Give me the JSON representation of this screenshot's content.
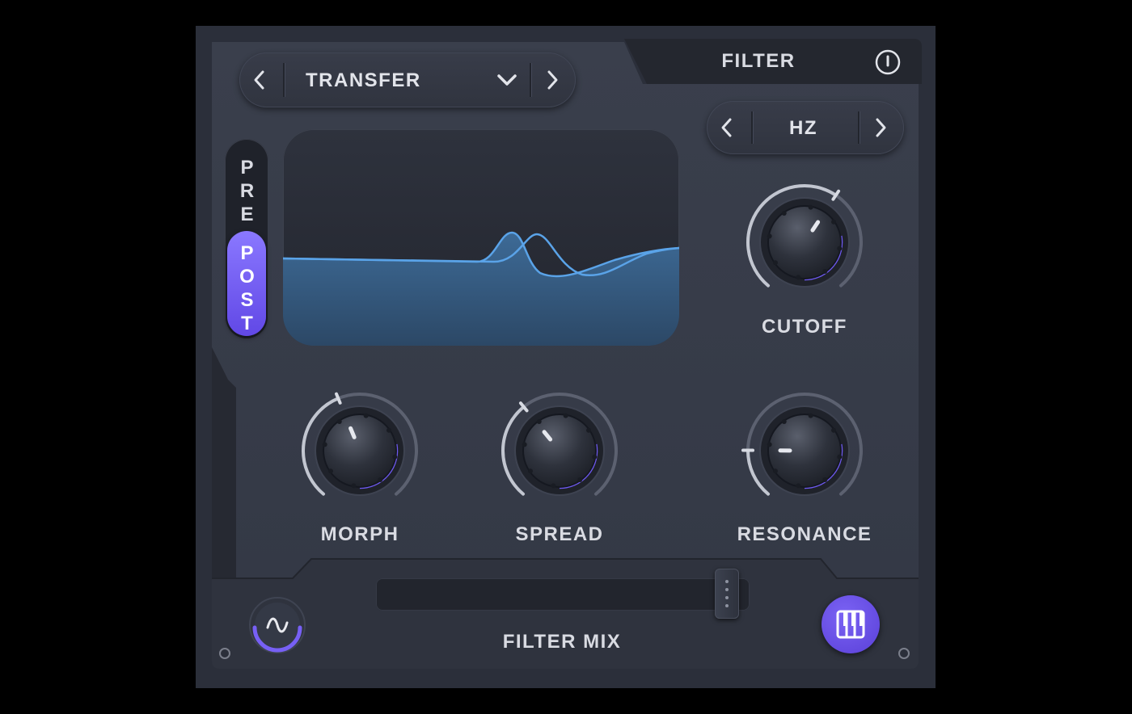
{
  "preset": {
    "name": "TRANSFER"
  },
  "section": {
    "title": "FILTER"
  },
  "unit_selector": {
    "value": "HZ"
  },
  "routing": {
    "pre_label": "PRE",
    "post_label": "POST",
    "selected": "POST"
  },
  "knobs": {
    "cutoff": {
      "label": "CUTOFF",
      "value": 0.62
    },
    "morph": {
      "label": "MORPH",
      "value": 0.42
    },
    "spread": {
      "label": "SPREAD",
      "value": 0.36
    },
    "resonance": {
      "label": "RESONANCE",
      "value": 0.18
    }
  },
  "filter_mix": {
    "label": "FILTER MIX",
    "value": 0.97
  },
  "icons": {
    "power": "power-icon",
    "lfo": "sine-wave-icon",
    "keyboard": "piano-keys-icon",
    "dropdown": "chevron-down-icon",
    "prev": "chevron-left-icon",
    "next": "chevron-right-icon"
  },
  "colors": {
    "accent": "#6c54f0",
    "curve": "#5aa3e8",
    "panel": "#353a46",
    "background": "#2b2f3a"
  }
}
